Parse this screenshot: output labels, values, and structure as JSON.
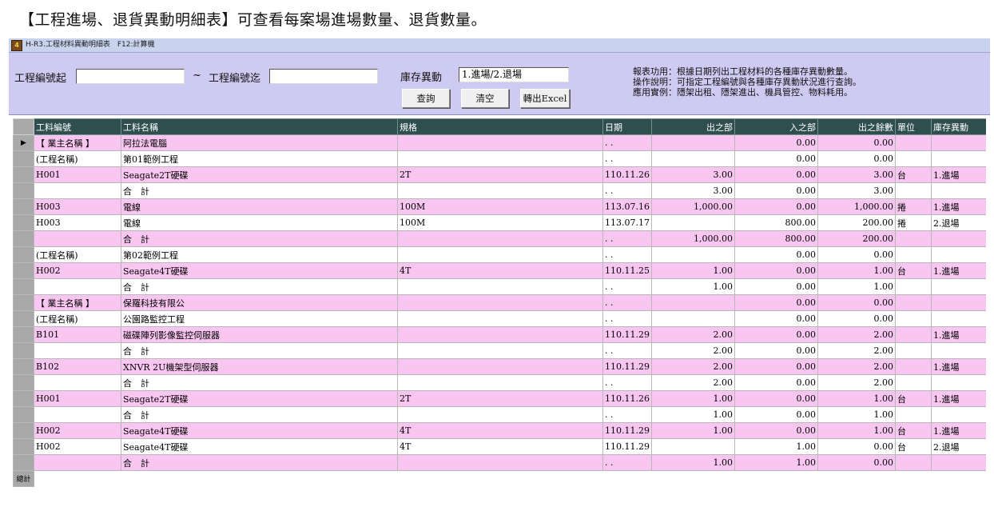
{
  "caption": "【工程進場、退貨異動明細表】可查看每案場進場數量、退貨數量。",
  "window": {
    "title": "H-R3.工程材料異動明細表　F12:計算機",
    "icon": "app-icon"
  },
  "filter": {
    "from_label": "工程編號起",
    "from_value": "",
    "tilde": "~",
    "to_label": "工程編號迄",
    "to_value": "",
    "change_label": "庫存異動",
    "change_value": "1.進場/2.退場",
    "query_button": "查詢",
    "clear_button": "清空",
    "excel_button": "轉出Excel",
    "help": [
      "報表功用：根據日期列出工程材料的各種庫存異動數量。",
      "操作說明：可指定工程編號與各種庫存異動狀況進行查詢。",
      "應用實例：隱架出租、隱架進出、機具管控、物料耗用。"
    ]
  },
  "grid": {
    "columns": [
      "工料編號",
      "工料名稱",
      "規格",
      "日期",
      "出之部",
      "入之部",
      "出之餘數",
      "單位",
      "庫存異動"
    ],
    "rows": [
      {
        "style": "pink",
        "code": "【 業主名稱 】",
        "name": "阿拉法電腦",
        "spec": "",
        "date": ". .",
        "out": "",
        "in": "0.00",
        "bal": "0.00",
        "unit": "",
        "change": "",
        "marker": "▶",
        "indent": true
      },
      {
        "style": "white",
        "code": "(工程名稱)",
        "name": "第01範例工程",
        "spec": "",
        "date": ". .",
        "out": "",
        "in": "0.00",
        "bal": "0.00",
        "unit": "",
        "change": "",
        "indent": true
      },
      {
        "style": "pink",
        "code": "H001",
        "name": "Seagate2T硬碟",
        "spec": "2T",
        "date": "110.11.26",
        "out": "3.00",
        "in": "0.00",
        "bal": "3.00",
        "unit": "台",
        "change": "1.進場"
      },
      {
        "style": "white",
        "code": "",
        "name": "合　計",
        "spec": "",
        "date": ". .",
        "out": "3.00",
        "in": "0.00",
        "bal": "3.00",
        "unit": "",
        "change": "",
        "total": true
      },
      {
        "style": "pink",
        "code": "H003",
        "name": "電線",
        "spec": "100M",
        "date": "113.07.16",
        "out": "1,000.00",
        "in": "0.00",
        "bal": "1,000.00",
        "unit": "捲",
        "change": "1.進場"
      },
      {
        "style": "white",
        "code": "H003",
        "name": "電線",
        "spec": "100M",
        "date": "113.07.17",
        "out": "",
        "in": "800.00",
        "bal": "200.00",
        "unit": "捲",
        "change": "2.退場"
      },
      {
        "style": "pink",
        "code": "",
        "name": "合　計",
        "spec": "",
        "date": ". .",
        "out": "1,000.00",
        "in": "800.00",
        "bal": "200.00",
        "unit": "",
        "change": "",
        "total": true
      },
      {
        "style": "white",
        "code": "(工程名稱)",
        "name": "第02範例工程",
        "spec": "",
        "date": ". .",
        "out": "",
        "in": "0.00",
        "bal": "0.00",
        "unit": "",
        "change": "",
        "indent": true
      },
      {
        "style": "pink",
        "code": "H002",
        "name": "Seagate4T硬碟",
        "spec": "4T",
        "date": "110.11.25",
        "out": "1.00",
        "in": "0.00",
        "bal": "1.00",
        "unit": "台",
        "change": "1.進場"
      },
      {
        "style": "white",
        "code": "",
        "name": "合　計",
        "spec": "",
        "date": ". .",
        "out": "1.00",
        "in": "0.00",
        "bal": "1.00",
        "unit": "",
        "change": "",
        "total": true
      },
      {
        "style": "pink",
        "code": "【 業主名稱 】",
        "name": "保羅科技有限公",
        "spec": "",
        "date": ". .",
        "out": "",
        "in": "0.00",
        "bal": "0.00",
        "unit": "",
        "change": "",
        "indent": true
      },
      {
        "style": "white",
        "code": "(工程名稱)",
        "name": "公園路監控工程",
        "spec": "",
        "date": ". .",
        "out": "",
        "in": "0.00",
        "bal": "0.00",
        "unit": "",
        "change": "",
        "indent": true
      },
      {
        "style": "pink",
        "code": "B101",
        "name": "磁碟陣列影像監控伺服器",
        "spec": "",
        "date": "110.11.29",
        "out": "2.00",
        "in": "0.00",
        "bal": "2.00",
        "unit": "",
        "change": "1.進場"
      },
      {
        "style": "white",
        "code": "",
        "name": "合　計",
        "spec": "",
        "date": ". .",
        "out": "2.00",
        "in": "0.00",
        "bal": "2.00",
        "unit": "",
        "change": "",
        "total": true
      },
      {
        "style": "pink",
        "code": "B102",
        "name": "XNVR 2U機架型伺服器",
        "spec": "",
        "date": "110.11.29",
        "out": "2.00",
        "in": "0.00",
        "bal": "2.00",
        "unit": "",
        "change": "1.進場"
      },
      {
        "style": "white",
        "code": "",
        "name": "合　計",
        "spec": "",
        "date": ". .",
        "out": "2.00",
        "in": "0.00",
        "bal": "2.00",
        "unit": "",
        "change": "",
        "total": true
      },
      {
        "style": "pink",
        "code": "H001",
        "name": "Seagate2T硬碟",
        "spec": "2T",
        "date": "110.11.26",
        "out": "1.00",
        "in": "0.00",
        "bal": "1.00",
        "unit": "台",
        "change": "1.進場"
      },
      {
        "style": "white",
        "code": "",
        "name": "合　計",
        "spec": "",
        "date": ". .",
        "out": "1.00",
        "in": "0.00",
        "bal": "1.00",
        "unit": "",
        "change": "",
        "total": true
      },
      {
        "style": "pink",
        "code": "H002",
        "name": "Seagate4T硬碟",
        "spec": "4T",
        "date": "110.11.29",
        "out": "1.00",
        "in": "0.00",
        "bal": "1.00",
        "unit": "台",
        "change": "1.進場"
      },
      {
        "style": "white",
        "code": "H002",
        "name": "Seagate4T硬碟",
        "spec": "4T",
        "date": "110.11.29",
        "out": "",
        "in": "1.00",
        "bal": "0.00",
        "unit": "台",
        "change": "2.退場"
      },
      {
        "style": "pink",
        "code": "",
        "name": "合　計",
        "spec": "",
        "date": ". .",
        "out": "1.00",
        "in": "1.00",
        "bal": "0.00",
        "unit": "",
        "change": "",
        "total": true
      }
    ],
    "footer_label": "總計"
  }
}
